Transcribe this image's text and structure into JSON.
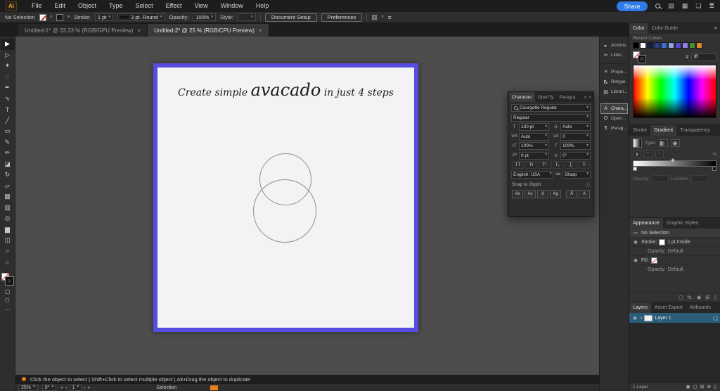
{
  "colors": {
    "accent_blue": "#2f7ce6",
    "artboard_border": "#564de0",
    "layer_selected": "#2b5d7a",
    "status_orange": "#e87f1a"
  },
  "icons": {
    "caret": "▾",
    "menu": "≣",
    "hamburger": "≡",
    "grid": "▦",
    "gallery": "▤",
    "window": "❏",
    "align_a": "▥",
    "align_b": "▤",
    "align_c": "▦",
    "info": "ⓘ",
    "close": "×",
    "collapse": "»",
    "eye": "◉",
    "chevron_right": "›",
    "nav_first": "«",
    "nav_prev": "‹",
    "nav_next": "›",
    "nav_last": "»",
    "target_circle": "◯",
    "antialias": "aa",
    "selection_box": "▭",
    "fx": "fx.",
    "square": "▢",
    "new_item": "⊞",
    "add": "⊕",
    "trash": "▯",
    "clip": "◻"
  },
  "menubar": {
    "logo": "Ai",
    "items": [
      "File",
      "Edit",
      "Object",
      "Type",
      "Select",
      "Effect",
      "View",
      "Window",
      "Help"
    ],
    "share_label": "Share"
  },
  "controlbar": {
    "selection_status": "No Selection",
    "stroke_label": "Stroke:",
    "stroke_weight": "1 pt",
    "brush_preset": "3 pt. Round",
    "opacity_label": "Opacity:",
    "opacity_value": "100%",
    "style_label": "Style:",
    "document_setup_label": "Document Setup",
    "preferences_label": "Preferences"
  },
  "document_tabs": [
    {
      "label": "Untitled-1* @ 33.33 % (RGB/GPU Preview)",
      "active": false,
      "close": "×"
    },
    {
      "label": "Untitled-2* @ 25 % (RGB/CPU Preview)",
      "active": true,
      "close": "×"
    }
  ],
  "toolbar_tools": [
    {
      "name": "selection-tool",
      "glyph": "▶",
      "active": true
    },
    {
      "name": "direct-selection-tool",
      "glyph": "▷",
      "active": false
    },
    {
      "name": "magic-wand-tool",
      "glyph": "✦",
      "active": false
    },
    {
      "name": "lasso-tool",
      "glyph": "◌",
      "active": false
    },
    {
      "name": "pen-tool",
      "glyph": "✒",
      "active": false
    },
    {
      "name": "curvature-tool",
      "glyph": "∿",
      "active": false
    },
    {
      "name": "type-tool",
      "glyph": "T",
      "active": false
    },
    {
      "name": "line-segment-tool",
      "glyph": "╱",
      "active": false
    },
    {
      "name": "rectangle-tool",
      "glyph": "▭",
      "active": false
    },
    {
      "name": "paintbrush-tool",
      "glyph": "✎",
      "active": false
    },
    {
      "name": "pencil-tool",
      "glyph": "✏",
      "active": false
    },
    {
      "name": "eraser-tool",
      "glyph": "◪",
      "active": false
    },
    {
      "name": "rotate-tool",
      "glyph": "↻",
      "active": false
    },
    {
      "name": "scale-tool",
      "glyph": "▱",
      "active": false
    },
    {
      "name": "width-tool",
      "glyph": "▦",
      "active": false
    },
    {
      "name": "gradient-tool",
      "glyph": "▥",
      "active": false
    },
    {
      "name": "eyedropper-tool",
      "glyph": "◎",
      "active": false
    },
    {
      "name": "blend-tool",
      "glyph": "▆",
      "active": false
    },
    {
      "name": "artboard-tool",
      "glyph": "◫",
      "active": false
    },
    {
      "name": "hand-tool",
      "glyph": "☞",
      "active": false
    },
    {
      "name": "zoom-tool",
      "glyph": "○",
      "active": false
    }
  ],
  "canvas": {
    "artboard_title_pre": "Create simple ",
    "artboard_title_word": "avacado",
    "artboard_title_post": " in just 4 steps"
  },
  "panel_strip": {
    "group1": [
      {
        "name": "panel-button-actions",
        "label": "Actions",
        "glyph": "▸",
        "active": false
      },
      {
        "name": "panel-button-links",
        "label": "Links",
        "glyph": "∞",
        "active": false
      }
    ],
    "group2": [
      {
        "name": "panel-button-properties",
        "label": "Prope...",
        "glyph": "≡",
        "active": false
      },
      {
        "name": "panel-button-retype",
        "label": "Retype",
        "glyph": "℞",
        "active": false
      },
      {
        "name": "panel-button-libraries",
        "label": "Librari...",
        "glyph": "▤",
        "active": false
      }
    ],
    "group3": [
      {
        "name": "panel-button-character",
        "label": "Chara...",
        "glyph": "A",
        "active": true
      },
      {
        "name": "panel-button-opentype",
        "label": "Open...",
        "glyph": "O",
        "active": false
      },
      {
        "name": "panel-button-paragraph",
        "label": "Parag...",
        "glyph": "¶",
        "active": false
      }
    ]
  },
  "character_panel": {
    "tabs": [
      {
        "label": "Character",
        "active": true
      },
      {
        "label": "OpenTy",
        "active": false
      },
      {
        "label": "Paragra",
        "active": false
      }
    ],
    "font_query": "Courgette Regular",
    "font_style": "Regular",
    "steppers": [
      {
        "name": "font-size-stepper",
        "icon": "T",
        "value": "130 pt"
      },
      {
        "name": "leading-stepper",
        "icon": "A",
        "value": "Auto"
      },
      {
        "name": "kerning-stepper",
        "icon": "V∕A",
        "value": "Auto"
      },
      {
        "name": "tracking-stepper",
        "icon": "VA",
        "value": "0"
      },
      {
        "name": "vertical-scale-stepper",
        "icon": "IT",
        "value": "100%"
      },
      {
        "name": "horizontal-scale-stepper",
        "icon": "T",
        "value": "100%"
      },
      {
        "name": "baseline-shift-stepper",
        "icon": "Aª",
        "value": "0 pt"
      },
      {
        "name": "character-rotation-stepper",
        "icon": "↻",
        "value": "0°"
      }
    ],
    "case_buttons": [
      "TT",
      "Tt",
      "T¹",
      "T₁",
      "T̲",
      "T̶"
    ],
    "language_value": "English: USA",
    "antialias_value": "Sharp",
    "snap_label": "Snap to Glyph",
    "snap_buttons": [
      "Ax",
      "Ax",
      "A̲",
      "Ag",
      "Å",
      "A"
    ]
  },
  "color_panel": {
    "tabs": [
      {
        "label": "Color",
        "active": true
      },
      {
        "label": "Color Guide",
        "active": false
      }
    ],
    "recent_label": "Recent Colors",
    "recent_swatches": [
      "#000000",
      "#ffffff",
      "#10203c",
      "#2b3f8c",
      "#3f6fd8",
      "#8fa8e0",
      "#5a48d0",
      "#9080e0",
      "#3f8f3f",
      "#e08828"
    ],
    "hex_prefix": "#",
    "hex_value": "fff"
  },
  "gradient_panel": {
    "tabs": [
      {
        "label": "Stroke",
        "active": false
      },
      {
        "label": "Gradient",
        "active": true
      },
      {
        "label": "Transparency",
        "active": false
      }
    ],
    "type_label": "Type:",
    "opacity_label": "Opacity:",
    "location_label": "Location:"
  },
  "appearance_panel": {
    "tabs": [
      {
        "label": "Appearance",
        "active": true
      },
      {
        "label": "Graphic Styles",
        "active": false
      }
    ],
    "selection_label": "No Selection",
    "rows": {
      "stroke_label": "Stroke:",
      "stroke_value": "1 pt Inside",
      "opacity_label": "Opacity:",
      "opacity_value": "Default",
      "fill_label": "Fill:",
      "opacity2_label": "Opacity:",
      "opacity2_value": "Default"
    }
  },
  "layers_panel": {
    "tabs": [
      {
        "label": "Layers",
        "active": true
      },
      {
        "label": "Asset Export",
        "active": false
      },
      {
        "label": "Artboards",
        "active": false
      }
    ],
    "layer_name": "Layer 1",
    "layer_count": "1 Layer"
  },
  "status_hint": {
    "text": "Click the object to select   |   Shift+Click to select multiple object   |   Alt+Drag the object to duplicate"
  },
  "bottom_bar": {
    "zoom": "25%",
    "rotation": "0°",
    "artboard_number": "1",
    "tool_status": "Selection"
  }
}
